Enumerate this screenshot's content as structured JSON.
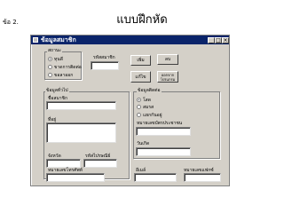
{
  "page": {
    "title": "แบบฝึกหัด",
    "item_no": "ข้อ 2."
  },
  "window": {
    "title": "ข้อมูลสมาชิก",
    "controls": [
      "_",
      "□",
      "×"
    ]
  },
  "status_group": {
    "label": "สถานะ",
    "options": [
      {
        "label": "ทุนดี",
        "selected": true
      },
      {
        "label": "ขาดการติดต่อ",
        "selected": false
      },
      {
        "label": "ขอลาออก",
        "selected": false
      }
    ]
  },
  "member_id": {
    "label": "รหัสสมาชิก",
    "value": ""
  },
  "buttons": {
    "add": "เพิ่ม",
    "delete": "ลบ",
    "edit": "แก้ไข",
    "exit": "ออกจากโปรแกรม"
  },
  "general_group": {
    "label": "ข้อมูลทั่วไป",
    "name_label": "ชื่อสมาชิก",
    "address_label": "ที่อยู่",
    "province_label": "จังหวัด",
    "postcode_label": "รหัสไปรษณีย์",
    "phone_label": "หมายเลขโทรศัพท์"
  },
  "contact_group": {
    "label": "ข้อมูลติดต่อ",
    "options": [
      {
        "label": "โสด",
        "selected": true
      },
      {
        "label": "สมรส",
        "selected": false
      },
      {
        "label": "แยกกันอยู่",
        "selected": false
      }
    ],
    "field1_label": "หมายเลขบัตรประชาชน",
    "field2_label": "วันเกิด",
    "field3_label": "อีเมล์",
    "field4_label": "หมายเลขแฟกซ์"
  }
}
